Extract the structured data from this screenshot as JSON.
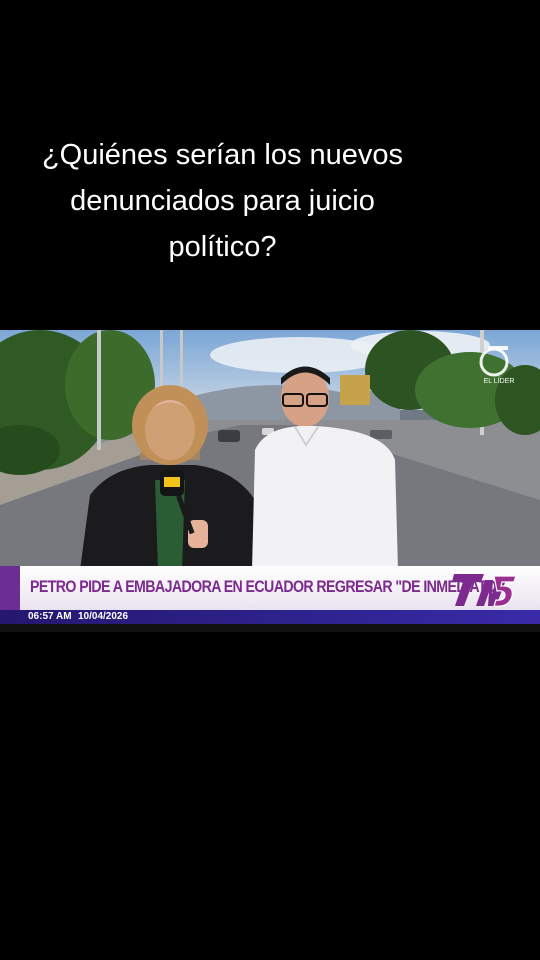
{
  "caption": {
    "line1": "¿Quiénes serían los nuevos",
    "line2": "denunciados para juicio",
    "line3": "político?"
  },
  "broadcast": {
    "headline": "PETRO PIDE A EMBAJADORA EN ECUADOR REGRESAR \"DE INMEDIATO\"",
    "time": "06:57 AM",
    "date": "10/04/2026",
    "channel_label": "EL LÍDER",
    "logo_icon": "tn5-logo-icon",
    "mic_label": "TN5",
    "colors": {
      "accent_purple": "#7c2a8e",
      "bar_blue": "#2f2390",
      "background": "#000000"
    }
  }
}
